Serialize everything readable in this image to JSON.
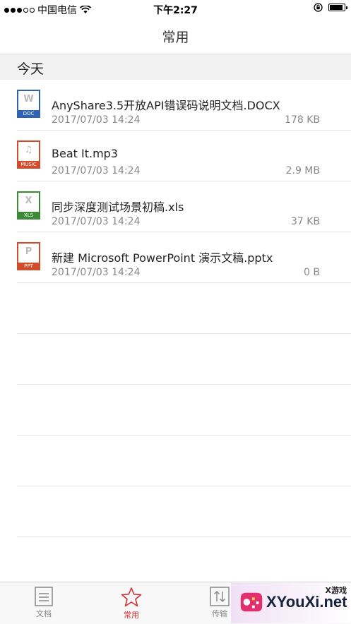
{
  "status": {
    "carrier": "中国电信",
    "time": "下午2:27",
    "battery_level": 0.9
  },
  "nav": {
    "title": "常用"
  },
  "section": {
    "title": "今天"
  },
  "files": [
    {
      "name": "AnyShare3.5开放API错误码说明文档.DOCX",
      "date": "2017/07/03 14:24",
      "size": "178 KB",
      "icon": "doc-file-icon",
      "icon_glyph": "W",
      "icon_tag": "DOC"
    },
    {
      "name": "Beat It.mp3",
      "date": "2017/07/03 14:24",
      "size": "2.9 MB",
      "icon": "music-file-icon",
      "icon_glyph": "♫",
      "icon_tag": "MUSIC"
    },
    {
      "name": "同步深度测试场景初稿.xls",
      "date": "2017/07/03 14:24",
      "size": "37 KB",
      "icon": "xls-file-icon",
      "icon_glyph": "X",
      "icon_tag": "XLS"
    },
    {
      "name": "新建 Microsoft PowerPoint 演示文稿.pptx",
      "date": "2017/07/03 14:24",
      "size": "0 B",
      "icon": "ppt-file-icon",
      "icon_glyph": "P",
      "icon_tag": "PPT"
    }
  ],
  "tabs": [
    {
      "label": "文档",
      "icon": "document-icon",
      "active": false
    },
    {
      "label": "常用",
      "icon": "star-icon",
      "active": true
    },
    {
      "label": "传输",
      "icon": "transfer-icon",
      "active": false
    }
  ],
  "watermark": {
    "small": "X游戏",
    "text": "XYouXi.net"
  },
  "colors": {
    "accent": "#d32f2f",
    "doc": "#2f62b3",
    "music": "#d24b2a",
    "xls": "#3d8b37",
    "ppt": "#d24b2a"
  }
}
